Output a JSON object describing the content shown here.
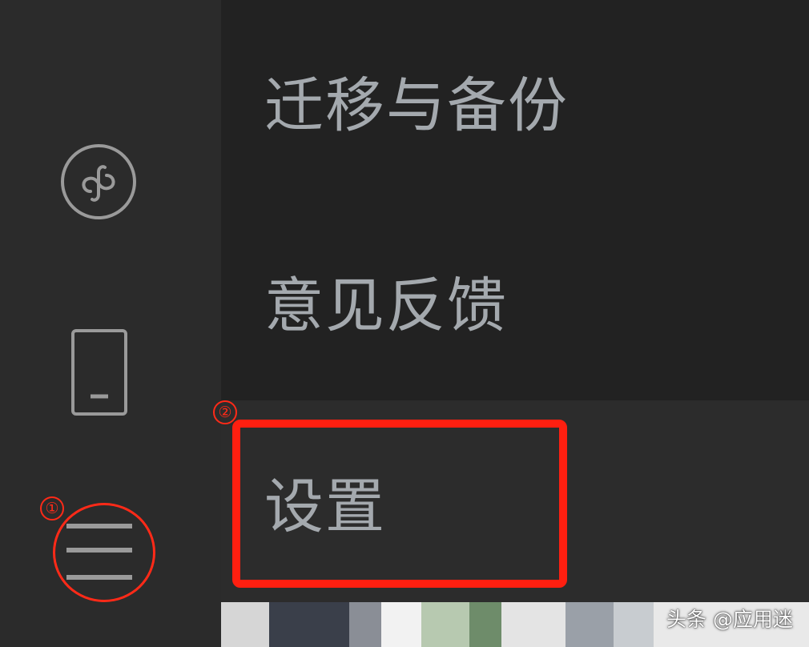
{
  "menu": {
    "items": [
      {
        "label": "迁移与备份"
      },
      {
        "label": "意见反馈"
      },
      {
        "label": "设置"
      }
    ]
  },
  "sidebar": {
    "icons": [
      "mini-program-icon",
      "phone-icon",
      "menu-icon"
    ]
  },
  "annotations": {
    "step1": "①",
    "step2": "②",
    "highlight_color": "#ff1f10"
  },
  "watermark": {
    "text": "头条 @应用迷"
  },
  "colors": {
    "sidebar_bg": "#2b2b2b",
    "menu_bg": "#222222",
    "menu_hover_bg": "#2c2c2c",
    "menu_text": "#a4a9ae",
    "icon_stroke": "#9a9a9a"
  }
}
